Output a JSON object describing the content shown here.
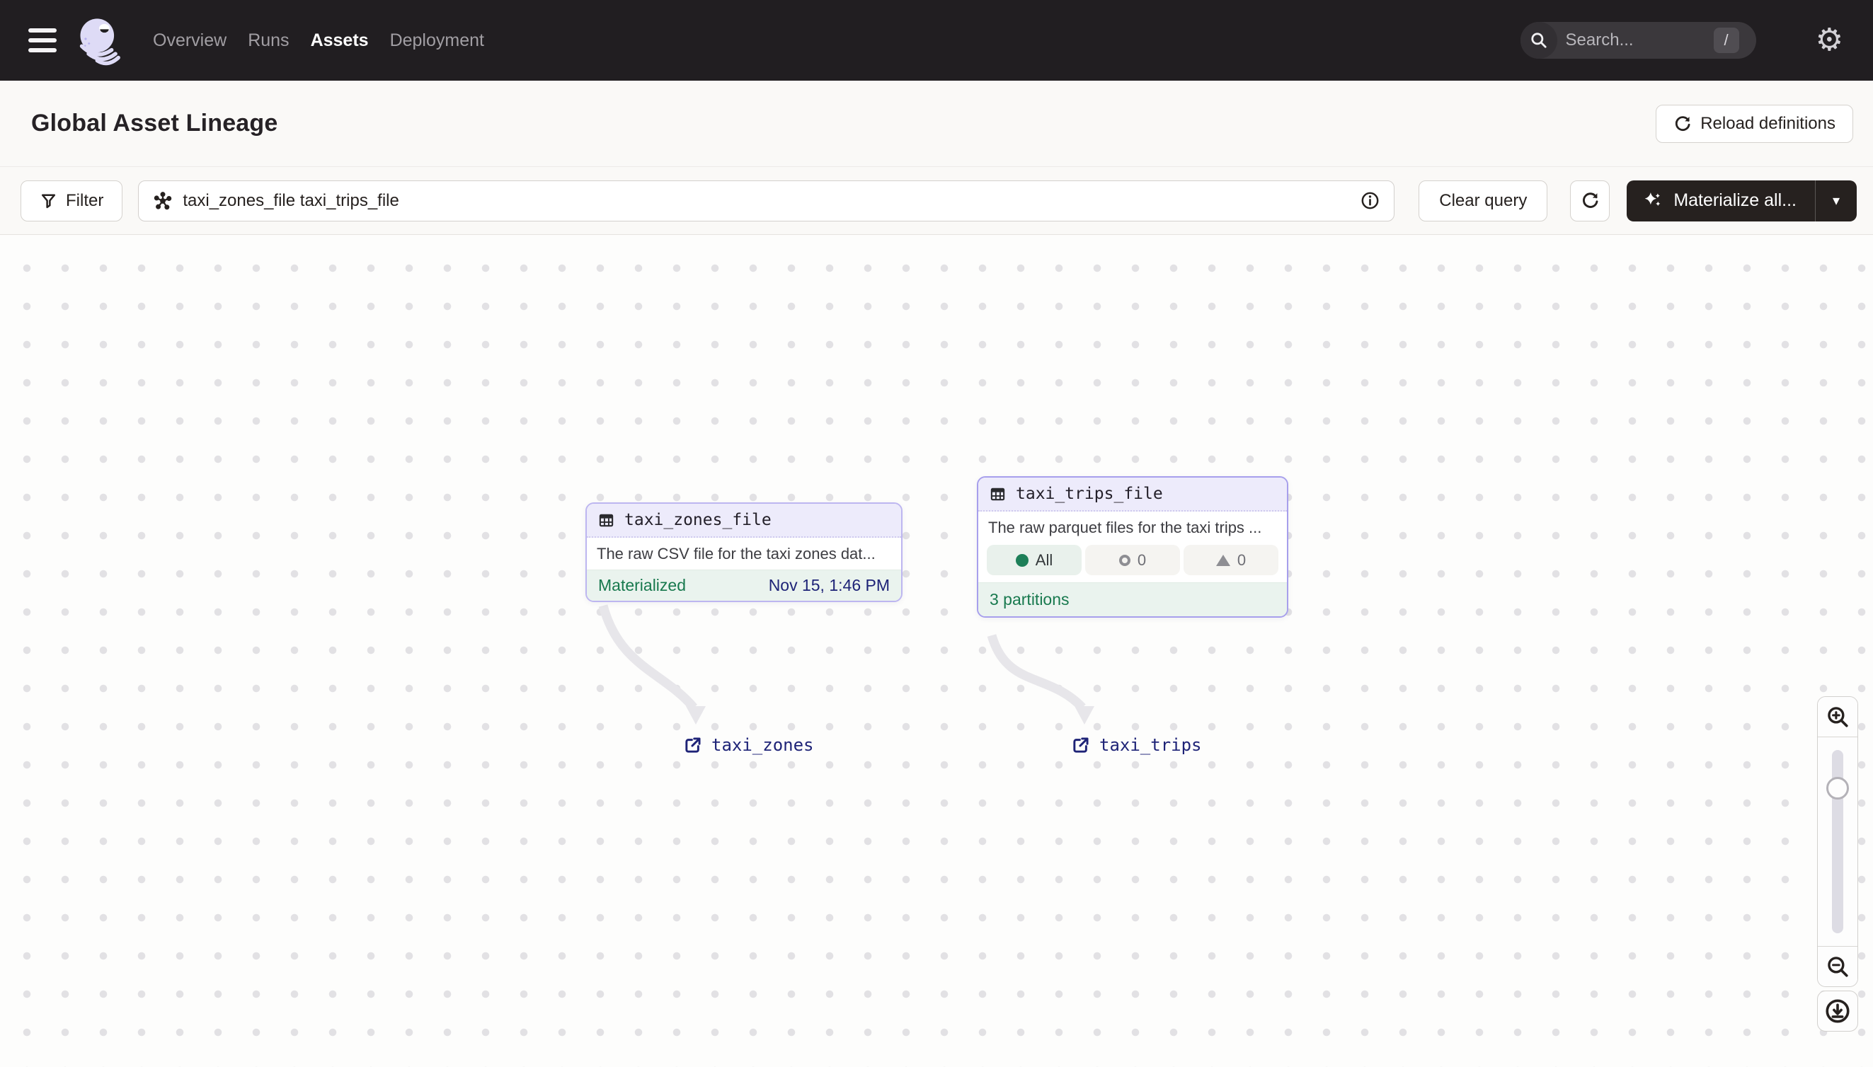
{
  "nav": {
    "links": [
      {
        "label": "Overview",
        "active": false
      },
      {
        "label": "Runs",
        "active": false
      },
      {
        "label": "Assets",
        "active": true
      },
      {
        "label": "Deployment",
        "active": false
      }
    ],
    "search": {
      "placeholder": "Search...",
      "shortcut": "/"
    },
    "gear_glyph": "⚙"
  },
  "header": {
    "title": "Global Asset Lineage",
    "reload_button_label": "Reload definitions"
  },
  "toolbar": {
    "filter_label": "Filter",
    "query_value": "taxi_zones_file taxi_trips_file",
    "clear_query_label": "Clear query",
    "materialize_label": "Materialize all...",
    "caret_glyph": "▾"
  },
  "graph": {
    "nodes": [
      {
        "title": "taxi_zones_file",
        "description": "The raw CSV file for the taxi zones dat...",
        "status_label": "Materialized",
        "status_time": "Nov 15, 1:46 PM"
      },
      {
        "title": "taxi_trips_file",
        "description": "The raw parquet files for the taxi trips ...",
        "partitions": {
          "all_label": "All",
          "failed_count": "0",
          "missing_count": "0"
        },
        "footer_label": "3 partitions"
      }
    ],
    "links": [
      {
        "label": "taxi_zones"
      },
      {
        "label": "taxi_trips"
      }
    ]
  }
}
